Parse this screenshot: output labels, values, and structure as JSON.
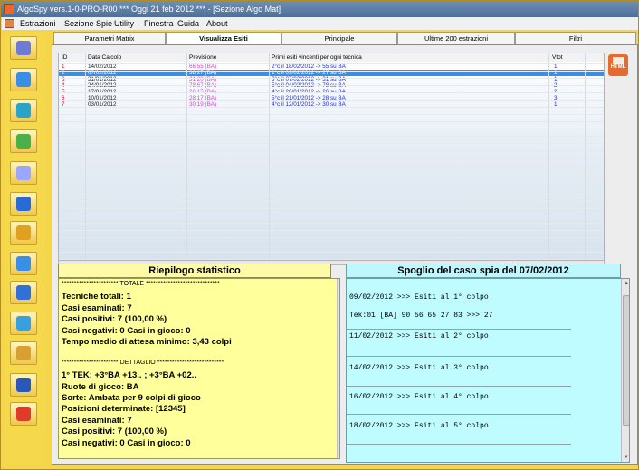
{
  "window": {
    "title": "AlgoSpy vers.1-0-PRO-R00  ***  Oggi 21 feb 2012  ***  - [Sezione Algo Mat]"
  },
  "menu": [
    "Estrazioni",
    "Sezione Spie",
    "Utility",
    "Finestra",
    "Guida",
    "About"
  ],
  "sidebar": {
    "icons": [
      "pencil-icon",
      "diamond-icon",
      "compass-icon",
      "checkmark-icon",
      "lightbulb-icon",
      "pointer-icon",
      "dollar-icon",
      "tree-icon",
      "calendar-icon",
      "drop-icon",
      "clock-icon",
      "book-icon",
      "power-icon"
    ]
  },
  "tabs": [
    "Parametri Matrix",
    "Visualizza Esiti",
    "Principale",
    "Ultime 200 estrazioni",
    "Filtri"
  ],
  "active_tab": "Visualizza Esiti",
  "grid": {
    "headers": [
      "ID",
      "Data Calcolo",
      "Previsione",
      "Primi esiti vincenti per ogni tecnica",
      "Vtot"
    ],
    "rows": [
      {
        "id": "1",
        "data": "14/02/2012",
        "prev": "66 55 (BA)",
        "esiti": "2°c il 18/02/2012 -> 55 su BA",
        "vtot": "1"
      },
      {
        "id": "2",
        "data": "07/02/2012",
        "prev": "38 27 (BA)",
        "esiti": "1°c il 09/02/2012 -> 27 su BA",
        "vtot": "1"
      },
      {
        "id": "3",
        "data": "31/01/2012",
        "prev": "31 20 (BA)",
        "esiti": "3°c il 07/02/2012 -> 31 su BA",
        "vtot": "1"
      },
      {
        "id": "4",
        "data": "24/01/2012",
        "prev": "78 67 (BA)",
        "esiti": "5°c il 04/02/2012 -> 78 su BA",
        "vtot": "2"
      },
      {
        "id": "5",
        "data": "17/01/2012",
        "prev": "26 15 (BA)",
        "esiti": "4°c il 26/01/2012 -> 26 su BA",
        "vtot": "2"
      },
      {
        "id": "6",
        "data": "10/01/2012",
        "prev": "28 17 (BA)",
        "esiti": "5°c il 21/01/2012 -> 28 su BA",
        "vtot": "3"
      },
      {
        "id": "7",
        "data": "03/01/2012",
        "prev": "30 19 (BA)",
        "esiti": "4°c il 12/01/2012 -> 30 su BA",
        "vtot": "1"
      }
    ],
    "selected_index": 1
  },
  "html_button": {
    "label": "HTML"
  },
  "left": {
    "title": "Riepilogo statistico",
    "lines": [
      "*********************** TOTALE ******************************",
      "Tecniche totali: 1",
      "Casi esaminati: 7",
      "Casi positivi: 7 (100,00 %)",
      "Casi negativi: 0  Casi in gioco: 0",
      "Tempo medio di attesa minimo: 3,43 colpi",
      "",
      "*********************** DETTAGLIO ***************************",
      "1° TEK: +3°BA +13.. ; +3°BA +02..",
      "Ruote di gioco: BA",
      "Sorte: Ambata per 9 colpi di gioco",
      "Posizioni determinate: [12345]",
      "Casi esaminati: 7",
      "Casi positivi: 7 (100,00 %)",
      "Casi negativi: 0  Casi in gioco: 0"
    ]
  },
  "right": {
    "title": "Spoglio del caso spia del 07/02/2012",
    "lines": [
      "09/02/2012 >>> Esiti al 1° colpo",
      "Tek:01    [BA] 90 56 65 27 83 >>> 27",
      "11/02/2012 >>> Esiti al 2° colpo",
      "14/02/2012 >>> Esiti al 3° colpo",
      "16/02/2012 >>> Esiti al 4° colpo",
      "18/02/2012 >>> Esiti al 5° colpo"
    ]
  },
  "colors": {
    "id": "#e0002a",
    "prev": "#e33ddc",
    "esiti": "#1d2bd6",
    "vtot": "#1d2bd6",
    "selected": "#3a8ee6"
  }
}
